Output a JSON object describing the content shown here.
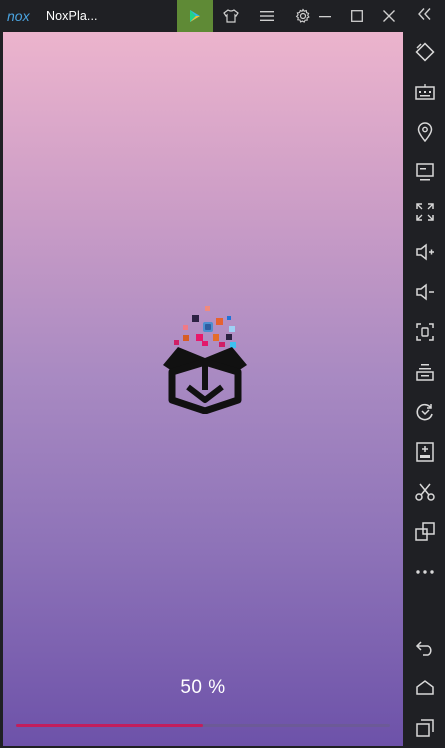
{
  "window": {
    "title": "NoxPla...",
    "logo_text": "nox"
  },
  "toolbar": {
    "icons": [
      "play-store-icon",
      "theme-shirt-icon",
      "menu-icon",
      "settings-icon"
    ]
  },
  "window_controls": {
    "icons": [
      "minimize-icon",
      "maximize-icon",
      "close-icon",
      "collapse-sidebar-icon"
    ]
  },
  "screen": {
    "progress_text": "50 %",
    "progress_value": 0.5,
    "colors": {
      "gradient_top": "#ecb4cd",
      "gradient_bottom": "#6d52a9",
      "progress_fill": "#c21e5d",
      "progress_track": "#6c5a97"
    }
  },
  "sidebar": {
    "items": [
      "rotate-screen-icon",
      "keyboard-icon",
      "location-icon",
      "screen-record-icon",
      "fullscreen-icon",
      "volume-up-icon",
      "volume-down-icon",
      "screenshot-icon",
      "multi-instance-icon",
      "sync-icon",
      "add-apk-icon",
      "scissors-icon",
      "copy-icon",
      "more-icon",
      "back-icon",
      "home-icon",
      "recent-apps-icon"
    ]
  }
}
